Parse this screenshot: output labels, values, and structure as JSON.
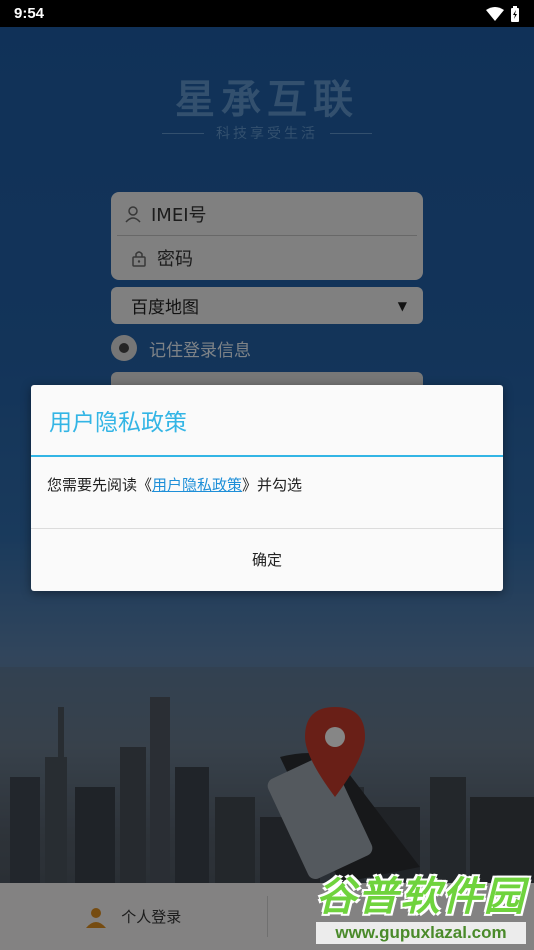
{
  "status_bar": {
    "time": "9:54"
  },
  "app": {
    "title": "星承互联",
    "subtitle": "科技享受生活",
    "imei_placeholder": "IMEI号",
    "password_placeholder": "密码",
    "map_select": "百度地图",
    "remember_label": "记住登录信息",
    "bottom_nav": [
      {
        "label": "个人登录"
      }
    ]
  },
  "dialog": {
    "title": "用户隐私政策",
    "body_prefix": "您需要先阅读《",
    "body_link": "用户隐私政策",
    "body_suffix": "》并勾选",
    "confirm_label": "确定"
  },
  "watermark": {
    "brand": "谷普软件园",
    "url": "www.gupuxlazal.com"
  },
  "colors": {
    "dialog_accent": "#33b5e5",
    "link": "#1e8fd8",
    "brand_blue": "#1e5aa0"
  }
}
